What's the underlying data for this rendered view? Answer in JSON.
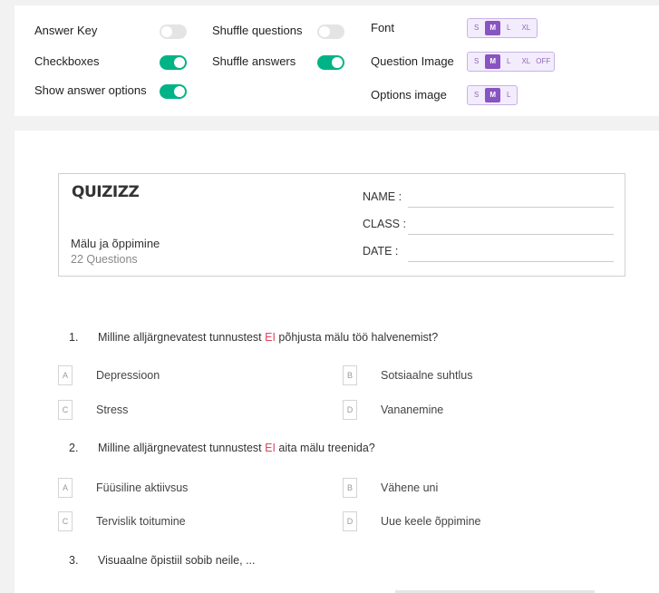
{
  "settings": {
    "answer_key": {
      "label": "Answer Key",
      "on": false
    },
    "checkboxes": {
      "label": "Checkboxes",
      "on": true
    },
    "show_answer_options": {
      "label": "Show answer options",
      "on": true
    },
    "shuffle_questions": {
      "label": "Shuffle questions",
      "on": false
    },
    "shuffle_answers": {
      "label": "Shuffle answers",
      "on": true
    },
    "font": {
      "label": "Font",
      "options": [
        "S",
        "M",
        "L",
        "XL"
      ],
      "selected": "M"
    },
    "question_image": {
      "label": "Question Image",
      "options": [
        "S",
        "M",
        "L",
        "XL",
        "OFF"
      ],
      "selected": "M"
    },
    "options_image": {
      "label": "Options image",
      "options": [
        "S",
        "M",
        "L"
      ],
      "selected": "M"
    }
  },
  "header": {
    "logo": "QUIZIZZ",
    "title": "Mälu ja õppimine",
    "count": "22 Questions",
    "name_label": "NAME :",
    "class_label": "CLASS :",
    "date_label": "DATE :"
  },
  "questions": [
    {
      "num": "1.",
      "pre": "Milline alljärgnevatest tunnustest ",
      "highlight": "EI",
      "post": " põhjusta mälu töö halvenemist?",
      "options": [
        {
          "letter": "A",
          "text": "Depressioon"
        },
        {
          "letter": "B",
          "text": "Sotsiaalne suhtlus"
        },
        {
          "letter": "C",
          "text": "Stress"
        },
        {
          "letter": "D",
          "text": "Vananemine"
        }
      ]
    },
    {
      "num": "2.",
      "pre": "Milline alljärgnevatest tunnustest ",
      "highlight": "EI",
      "post": " aita mälu treenida?",
      "options": [
        {
          "letter": "A",
          "text": "Füüsiline aktiivsus"
        },
        {
          "letter": "B",
          "text": "Vähene uni"
        },
        {
          "letter": "C",
          "text": "Tervislik toitumine"
        },
        {
          "letter": "D",
          "text": "Uue keele õppimine"
        }
      ]
    },
    {
      "num": "3.",
      "pre": "Visuaalne õpistiil sobib neile, ...",
      "highlight": "",
      "post": ""
    }
  ]
}
